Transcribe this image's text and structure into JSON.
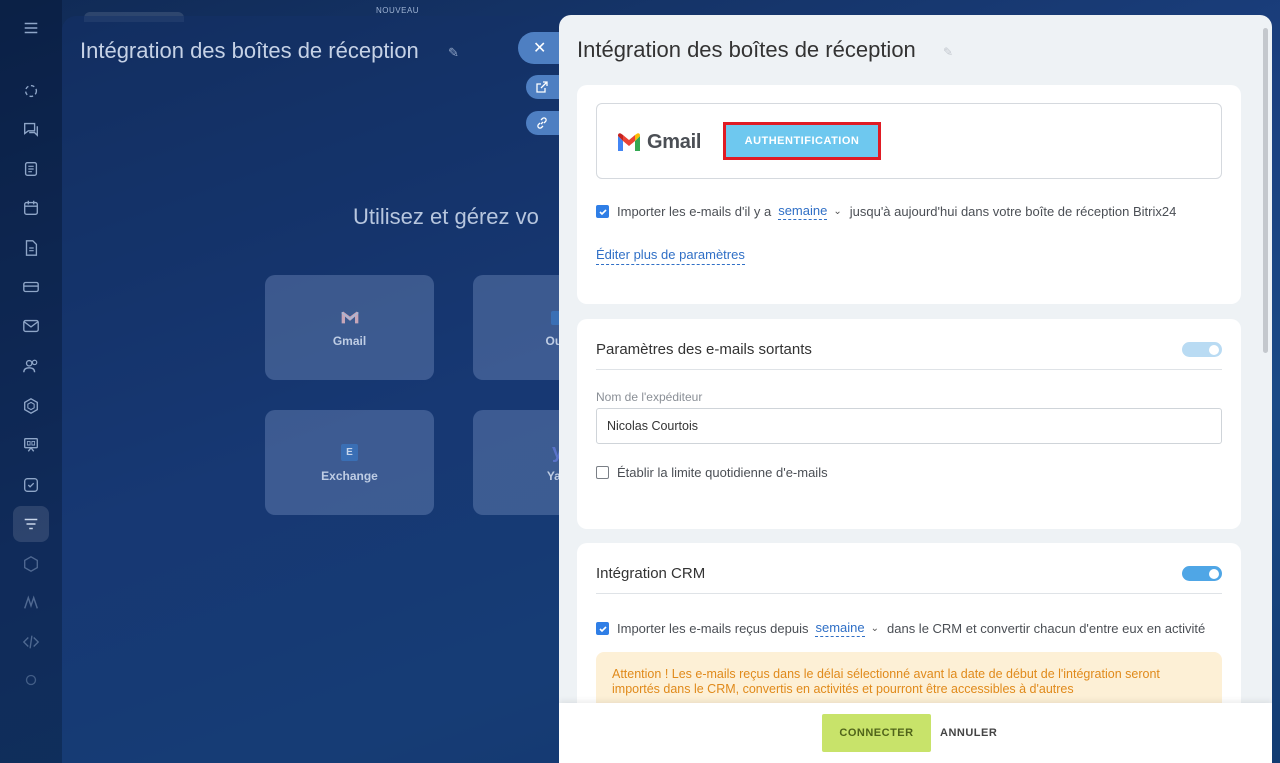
{
  "topbar": {
    "new_label": "NOUVEAU"
  },
  "background_panel": {
    "title": "Intégration des boîtes de réception",
    "heading": "Utilisez et gérez vo",
    "services": [
      {
        "name": "Gmail"
      },
      {
        "name": "Outl"
      },
      {
        "name": "Exchange"
      },
      {
        "name": "Yah"
      }
    ],
    "exchange_logo_letter": "E"
  },
  "slider": {
    "title": "Intégration des boîtes de réception",
    "gmail": {
      "label": "Gmail",
      "auth_button": "AUTHENTIFICATION"
    },
    "import_row": {
      "before": "Importer les e-mails d'il y a",
      "period": "semaine",
      "after": "jusqu'à aujourd'hui dans votre boîte de réception Bitrix24",
      "checked": true
    },
    "edit_more_link": "Éditer plus de paramètres",
    "outgoing": {
      "title": "Paramètres des e-mails sortants",
      "toggle_on": true,
      "sender_label": "Nom de l'expéditeur",
      "sender_value": "Nicolas Courtois",
      "daily_limit_label": "Établir la limite quotidienne d'e-mails",
      "daily_limit_checked": false
    },
    "crm": {
      "title": "Intégration CRM",
      "toggle_on": true,
      "import_before": "Importer les e-mails reçus depuis",
      "import_period": "semaine",
      "import_after": "dans le CRM et convertir chacun d'entre eux en activité",
      "import_checked": true,
      "warning": "Attention ! Les e-mails reçus dans le délai sélectionné avant la date de début de l'intégration seront importés dans le CRM, convertis en activités et pourront être accessibles à d'autres"
    },
    "footer": {
      "connect": "CONNECTER",
      "cancel": "ANNULER"
    }
  },
  "colors": {
    "accent": "#2f7ee6",
    "auth_button": "#6ec8ef",
    "highlight_border": "#e01b24",
    "connect_button": "#c8e36a",
    "warning_bg": "#fdf0d6",
    "warning_text": "#e08a1b"
  },
  "icons": {
    "leftnav": [
      "menu-icon",
      "flow-icon",
      "chat-icon",
      "feed-icon",
      "calendar-icon",
      "document-icon",
      "payments-icon",
      "mail-icon",
      "contacts-icon",
      "sites-icon",
      "marketing-icon",
      "tasks-icon",
      "filter-icon",
      "store-icon",
      "automation-icon",
      "developer-icon",
      "more-icon"
    ]
  }
}
